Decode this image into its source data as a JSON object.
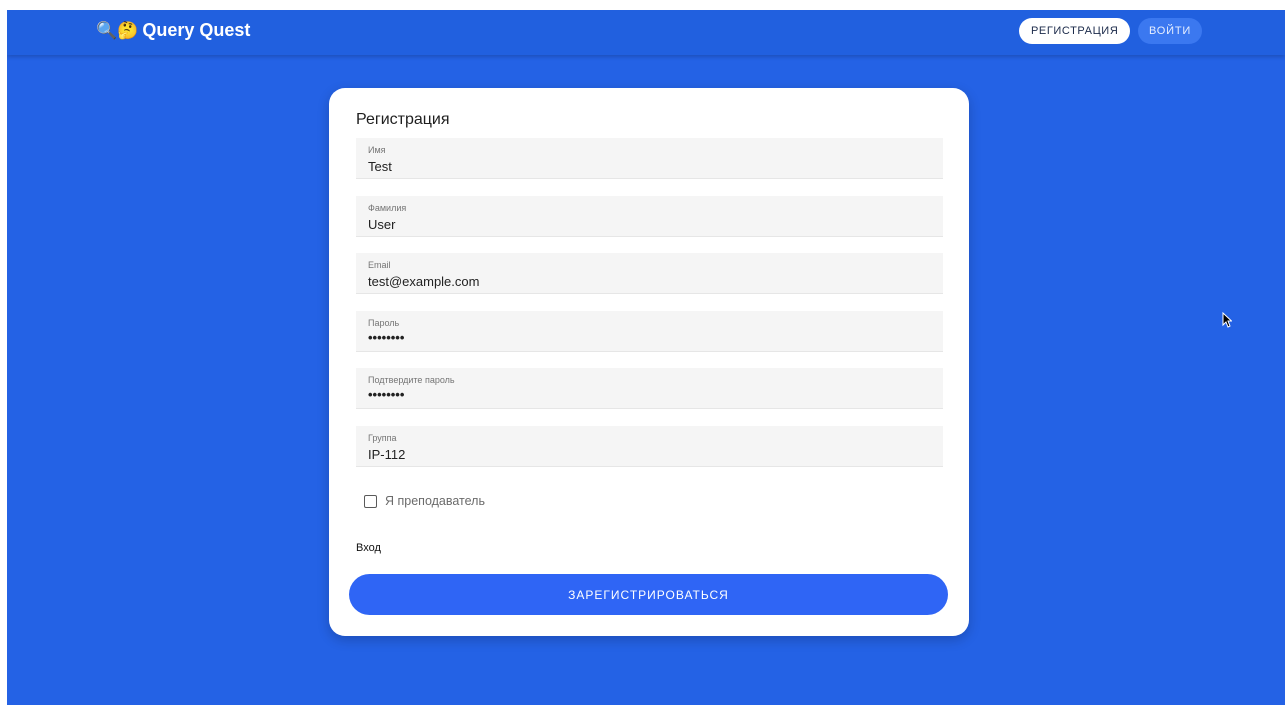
{
  "header": {
    "logo_emojis": "🔍🤔",
    "title": "Query Quest",
    "register_label": "РЕГИСТРАЦИЯ",
    "login_label": "ВОЙТИ"
  },
  "form": {
    "title": "Регистрация",
    "fields": [
      {
        "label": "Имя",
        "value": "Test",
        "type": "text"
      },
      {
        "label": "Фамилия",
        "value": "User",
        "type": "text"
      },
      {
        "label": "Email",
        "value": "test@example.com",
        "type": "email"
      },
      {
        "label": "Пароль",
        "value": "••••••••",
        "type": "password"
      },
      {
        "label": "Подтвердите пароль",
        "value": "••••••••",
        "type": "password"
      },
      {
        "label": "Группа",
        "value": "IP-112",
        "type": "text"
      }
    ],
    "teacher_checkbox_label": "Я преподаватель",
    "teacher_checked": false,
    "login_link": "Вход",
    "submit_label": "ЗАРЕГИСТРИРОВАТЬСЯ"
  },
  "colors": {
    "background": "#2462e5",
    "appbar": "#2160df",
    "primary_button": "#2f65f5"
  }
}
